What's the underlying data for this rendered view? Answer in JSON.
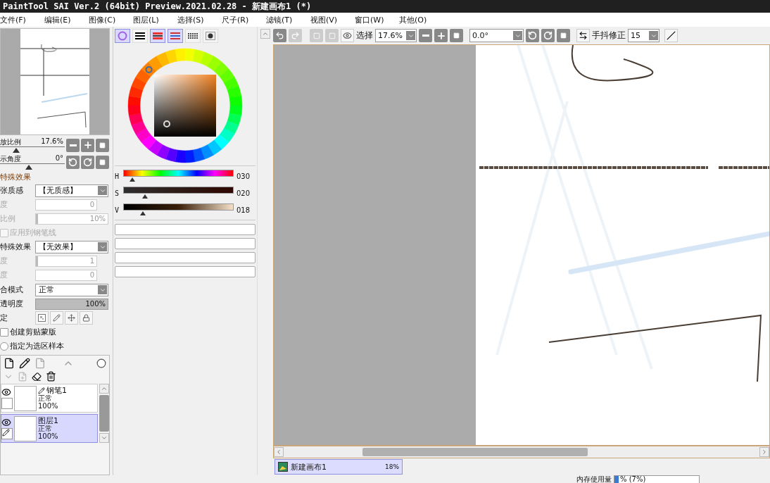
{
  "window": {
    "title": "PaintTool SAI Ver.2 (64bit) Preview.2021.02.28 - 新建画布1 (*)"
  },
  "menu": [
    {
      "label": "文件(F)"
    },
    {
      "label": "编辑(E)"
    },
    {
      "label": "图像(C)"
    },
    {
      "label": "图层(L)"
    },
    {
      "label": "选择(S)"
    },
    {
      "label": "尺子(R)"
    },
    {
      "label": "滤镜(T)"
    },
    {
      "label": "视图(V)"
    },
    {
      "label": "窗口(W)"
    },
    {
      "label": "其他(O)"
    }
  ],
  "navigator": {
    "sliders": [
      {
        "label": "放比例",
        "value": "17.6%",
        "level": 0.25
      },
      {
        "label": "示角度",
        "value": "0°",
        "level": 0.45
      }
    ]
  },
  "effects": {
    "heading": "特殊效果",
    "rows": [
      {
        "kind": "select",
        "label": "张质感",
        "value": "【无质感】",
        "disabled": false
      },
      {
        "kind": "field",
        "label": "度",
        "value": "0",
        "disabled": true
      },
      {
        "kind": "meter",
        "label": "比例",
        "value": "10%",
        "level": 0.02,
        "disabled": true
      },
      {
        "kind": "checkbox",
        "label": "应用到钢笔线",
        "checked": false,
        "disabled": true
      },
      {
        "kind": "select",
        "label": "特殊效果",
        "value": "【无效果】",
        "disabled": false
      },
      {
        "kind": "meter",
        "label": "度",
        "value": "1",
        "level": 0.03,
        "disabled": true
      },
      {
        "kind": "field",
        "label": "度",
        "value": "0",
        "disabled": true
      }
    ]
  },
  "layer_props": {
    "blend_label": "合模式",
    "blend_value": "正常",
    "opacity": {
      "label": "透明度",
      "value": "100%",
      "level": 1
    },
    "lock_label": "定",
    "options": [
      {
        "kind": "checkbox",
        "label": "创建剪贴蒙版",
        "checked": false
      },
      {
        "kind": "radio",
        "label": "指定为选区样本",
        "checked": false
      }
    ]
  },
  "layers": [
    {
      "name": "钢笔1",
      "mode": "正常",
      "opacity": "100%",
      "kind": "pen",
      "visible": true,
      "selected": false
    },
    {
      "name": "图层1",
      "mode": "正常",
      "opacity": "100%",
      "kind": "raster",
      "visible": true,
      "selected": true
    }
  ],
  "color_tabs": [
    {
      "kind": "wheel",
      "selected": true
    },
    {
      "kind": "bars",
      "selected": false
    },
    {
      "kind": "rgb",
      "selected": true
    },
    {
      "kind": "hsv",
      "selected": true
    },
    {
      "kind": "swatches",
      "selected": false
    },
    {
      "kind": "scratch",
      "selected": false
    }
  ],
  "hsv": [
    {
      "label": "H",
      "value": "030",
      "level": 0.083,
      "kind": "hue"
    },
    {
      "label": "S",
      "value": "020",
      "level": 0.2,
      "kind": "sat"
    },
    {
      "label": "V",
      "value": "018",
      "level": 0.18,
      "kind": "val"
    }
  ],
  "toolbar": {
    "select_label": "选择",
    "zoom": "17.6%",
    "angle": "0.0°",
    "stabilizer_label": "手抖修正",
    "stabilizer": "15"
  },
  "documents": [
    {
      "name": "新建画布1",
      "zoom": "18%",
      "selected": true
    }
  ],
  "status": {
    "memory": {
      "label": "内存使用量",
      "value": "% (7%)",
      "level": 0.05
    }
  }
}
